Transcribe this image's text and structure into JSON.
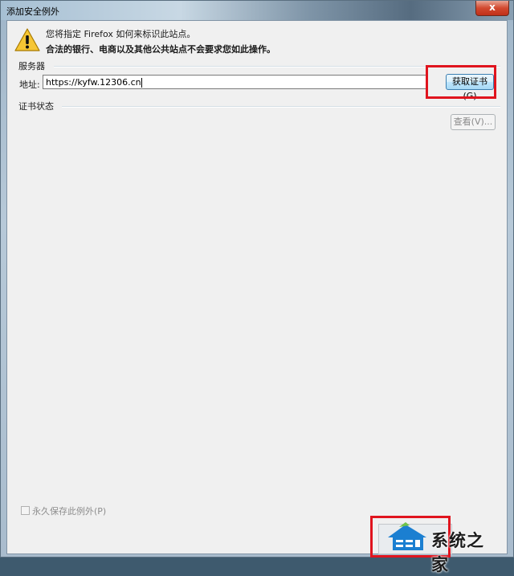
{
  "window": {
    "title": "添加安全例外",
    "close_glyph": "x"
  },
  "message": {
    "line1": "您将指定 Firefox 如何来标识此站点。",
    "line2": "合法的银行、电商以及其他公共站点不会要求您如此操作。"
  },
  "server": {
    "group_label": "服务器",
    "address_label": "地址:",
    "address_value": "https://kyfw.12306.cn",
    "fetch_button": "获取证书(G)"
  },
  "cert_status": {
    "group_label": "证书状态",
    "view_button": "查看(V)..."
  },
  "permanent_checkbox": {
    "label": "永久保存此例外(P)",
    "checked": false
  },
  "watermark": {
    "text": "系统之家"
  },
  "colors": {
    "highlight": "#e0141e",
    "accent": "#3c7fb1"
  }
}
